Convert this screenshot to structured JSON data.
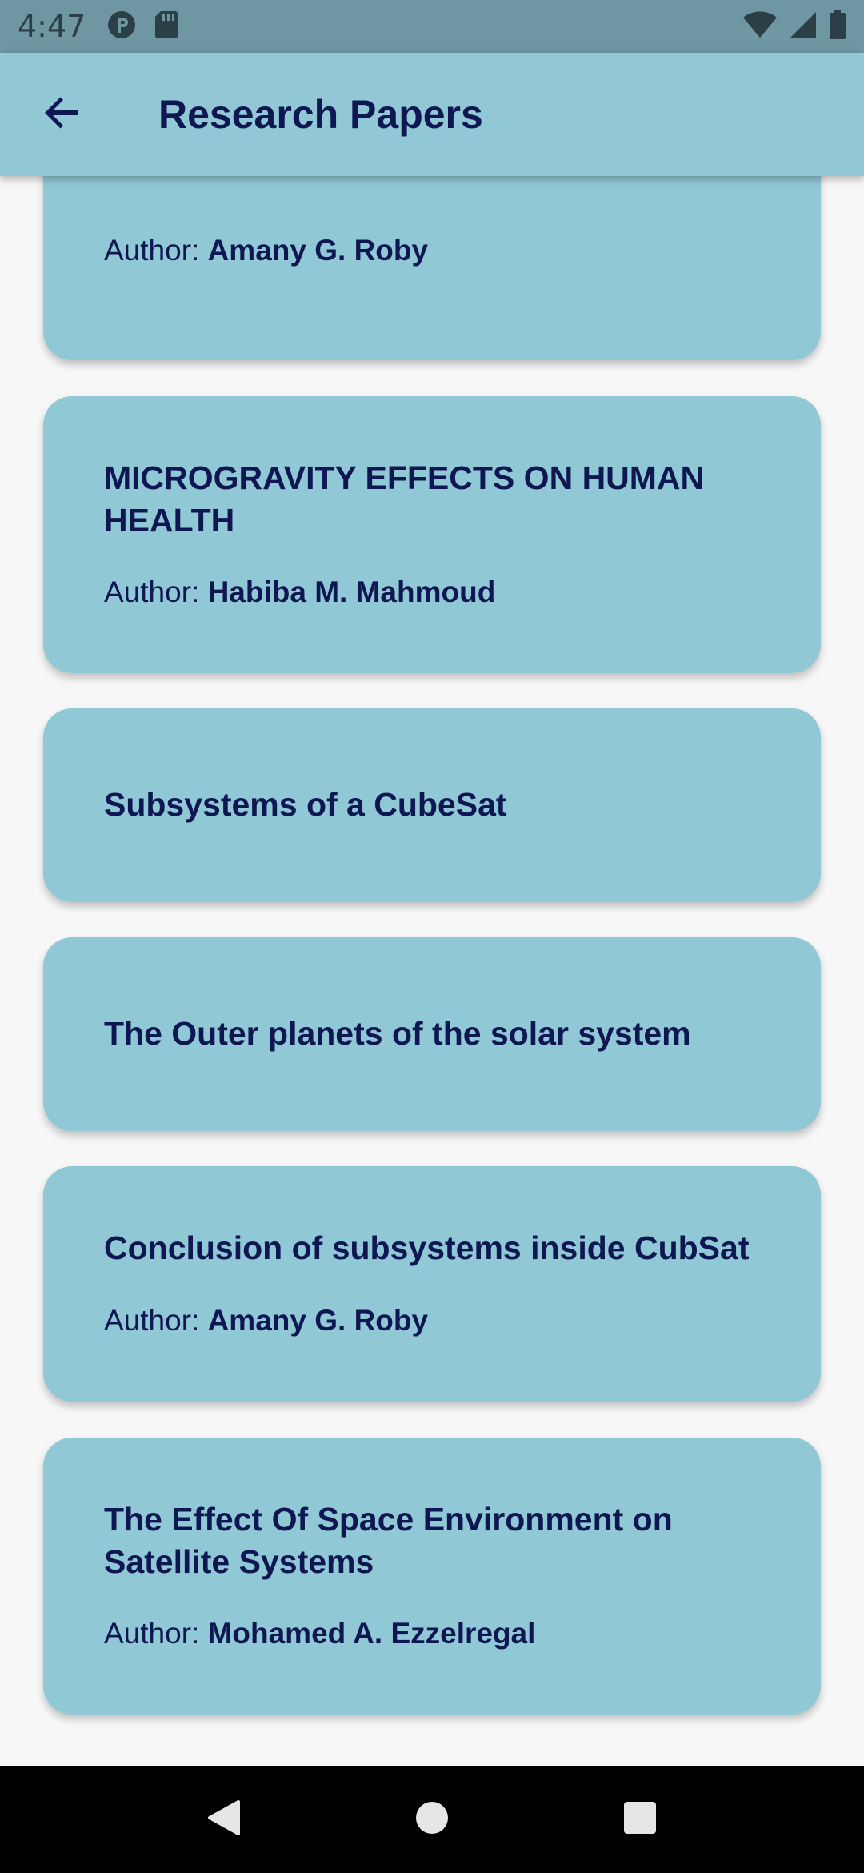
{
  "status_bar": {
    "time": "4:47"
  },
  "app_bar": {
    "title": "Research Papers"
  },
  "papers": [
    {
      "title": "",
      "author_prefix": "Author: ",
      "author": "Amany G. Roby"
    },
    {
      "title": "MICROGRAVITY EFFECTS ON HUMAN HEALTH",
      "author_prefix": "Author: ",
      "author": "Habiba M. Mahmoud"
    },
    {
      "title": "Subsystems of a CubeSat"
    },
    {
      "title": "The Outer planets of the solar system"
    },
    {
      "title": "Conclusion of subsystems inside CubSat",
      "author_prefix": "Author: ",
      "author": "Amany G. Roby"
    },
    {
      "title": "The Effect Of Space Environment on Satellite Systems",
      "author_prefix": "Author: ",
      "author": "Mohamed A. Ezzelregal"
    }
  ],
  "icons": {
    "back": "arrow-left-icon",
    "nav_back": "triangle-back-icon",
    "nav_home": "circle-home-icon",
    "nav_recents": "square-recents-icon"
  },
  "colors": {
    "app_bar": "#92c8d6",
    "card": "#91c8d5",
    "text": "#0e1752",
    "status_bar": "#6f97a3"
  }
}
